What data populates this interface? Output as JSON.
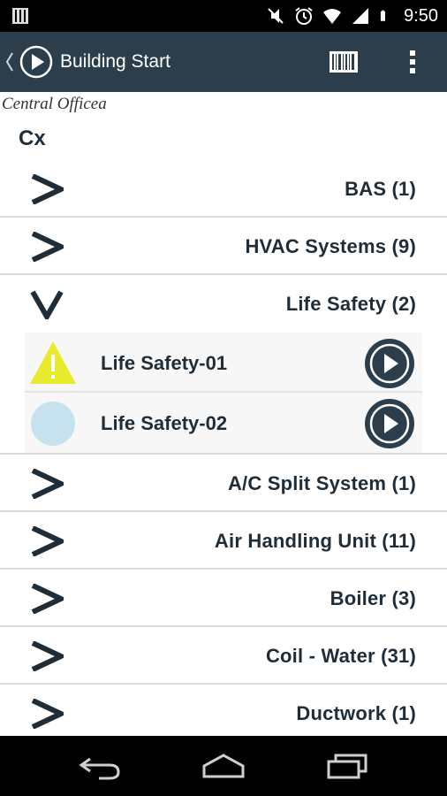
{
  "status_bar": {
    "time": "9:50",
    "icons": [
      "notification-icon",
      "mute-icon",
      "alarm-icon",
      "wifi-icon",
      "signal-icon",
      "battery-icon"
    ]
  },
  "action_bar": {
    "title": "Building Start",
    "icons": [
      "back-chevron-icon",
      "app-play-icon",
      "barcode-icon",
      "overflow-menu-icon"
    ],
    "background": "#2c3e4c"
  },
  "header": {
    "site_name": "Central Officea",
    "heading": "Cx"
  },
  "groups": [
    {
      "label": "BAS (1)",
      "expanded": false
    },
    {
      "label": "HVAC Systems (9)",
      "expanded": false
    },
    {
      "label": "Life Safety (2)",
      "expanded": true,
      "children": [
        {
          "label": "Life Safety-01",
          "status_icon": "warning-icon",
          "status_color": "#e8ea2e"
        },
        {
          "label": "Life Safety-02",
          "status_icon": "circle-status-icon",
          "status_color": "#c6e2ee"
        }
      ]
    },
    {
      "label": "A/C Split System (1)",
      "expanded": false
    },
    {
      "label": "Air Handling Unit (11)",
      "expanded": false
    },
    {
      "label": "Boiler (3)",
      "expanded": false
    },
    {
      "label": "Coil - Water (31)",
      "expanded": false
    },
    {
      "label": "Ductwork (1)",
      "expanded": false
    }
  ],
  "colors": {
    "accent_dark": "#2c3e4c",
    "text_dark": "#1f2d38"
  },
  "nav_bar": {
    "buttons": [
      "back-icon",
      "home-icon",
      "recents-icon"
    ]
  }
}
